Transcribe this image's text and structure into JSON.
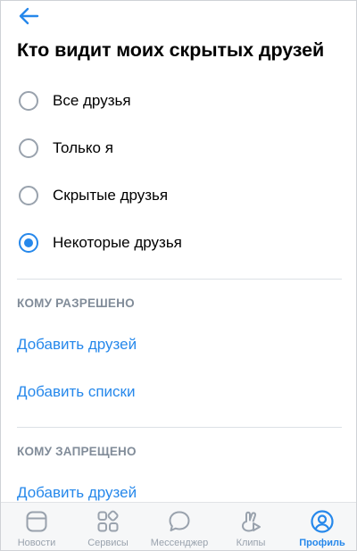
{
  "header": {
    "back_icon": "arrow-left-icon",
    "title": "Кто видит моих скрытых друзей"
  },
  "options": [
    {
      "label": "Все друзья",
      "checked": false
    },
    {
      "label": "Только я",
      "checked": false
    },
    {
      "label": "Скрытые друзья",
      "checked": false
    },
    {
      "label": "Некоторые друзья",
      "checked": true
    }
  ],
  "allowed": {
    "header": "КОМУ РАЗРЕШЕНО",
    "add_friends": "Добавить друзей",
    "add_lists": "Добавить списки"
  },
  "denied": {
    "header": "КОМУ ЗАПРЕЩЕНО",
    "add_friends": "Добавить друзей"
  },
  "tabbar": {
    "tabs": [
      {
        "label": "Новости",
        "icon": "news-icon",
        "active": false
      },
      {
        "label": "Сервисы",
        "icon": "services-icon",
        "active": false
      },
      {
        "label": "Мессенджер",
        "icon": "messenger-icon",
        "active": false
      },
      {
        "label": "Клипы",
        "icon": "clips-icon",
        "active": false
      },
      {
        "label": "Профиль",
        "icon": "profile-icon",
        "active": true
      }
    ]
  },
  "colors": {
    "accent": "#2688eb",
    "secondary_text": "#818c99",
    "inactive_icon": "#99a2ad",
    "tabbar_bg": "#f6f7f8"
  }
}
